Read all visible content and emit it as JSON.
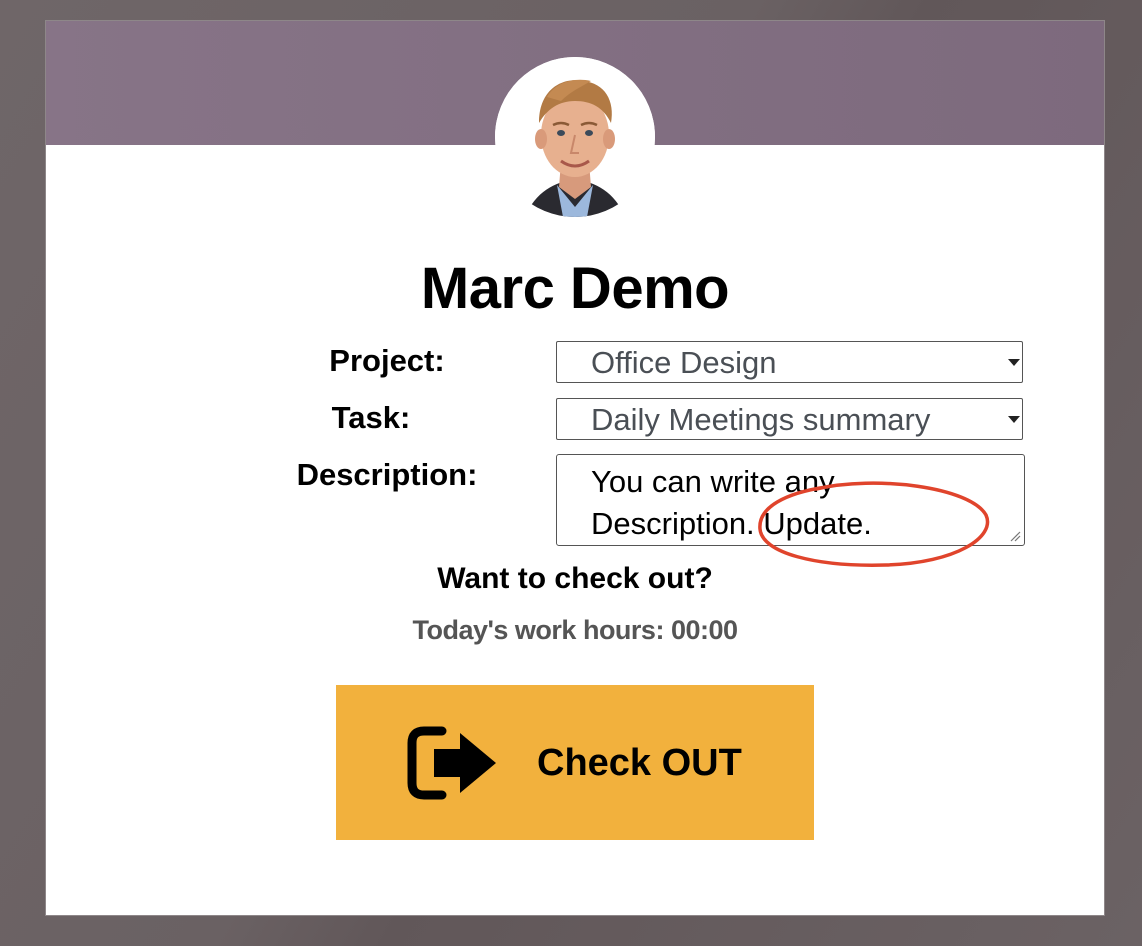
{
  "user": {
    "name": "Marc Demo"
  },
  "form": {
    "project_label": "Project:",
    "project_value": "Office Design",
    "task_label": "Task:",
    "task_value": "Daily Meetings summary",
    "description_label": "Description:",
    "description_value": "You can write any Description. Update."
  },
  "status": {
    "prompt": "Want to check out?",
    "work_hours": "Today's work hours: 00:00"
  },
  "action": {
    "checkout_label": "Check OUT",
    "checkout_icon": "sign-out-icon",
    "button_color": "#f2b13d"
  },
  "annotation": {
    "color": "#e0442c"
  },
  "header": {
    "color": "#7f6c7f"
  }
}
